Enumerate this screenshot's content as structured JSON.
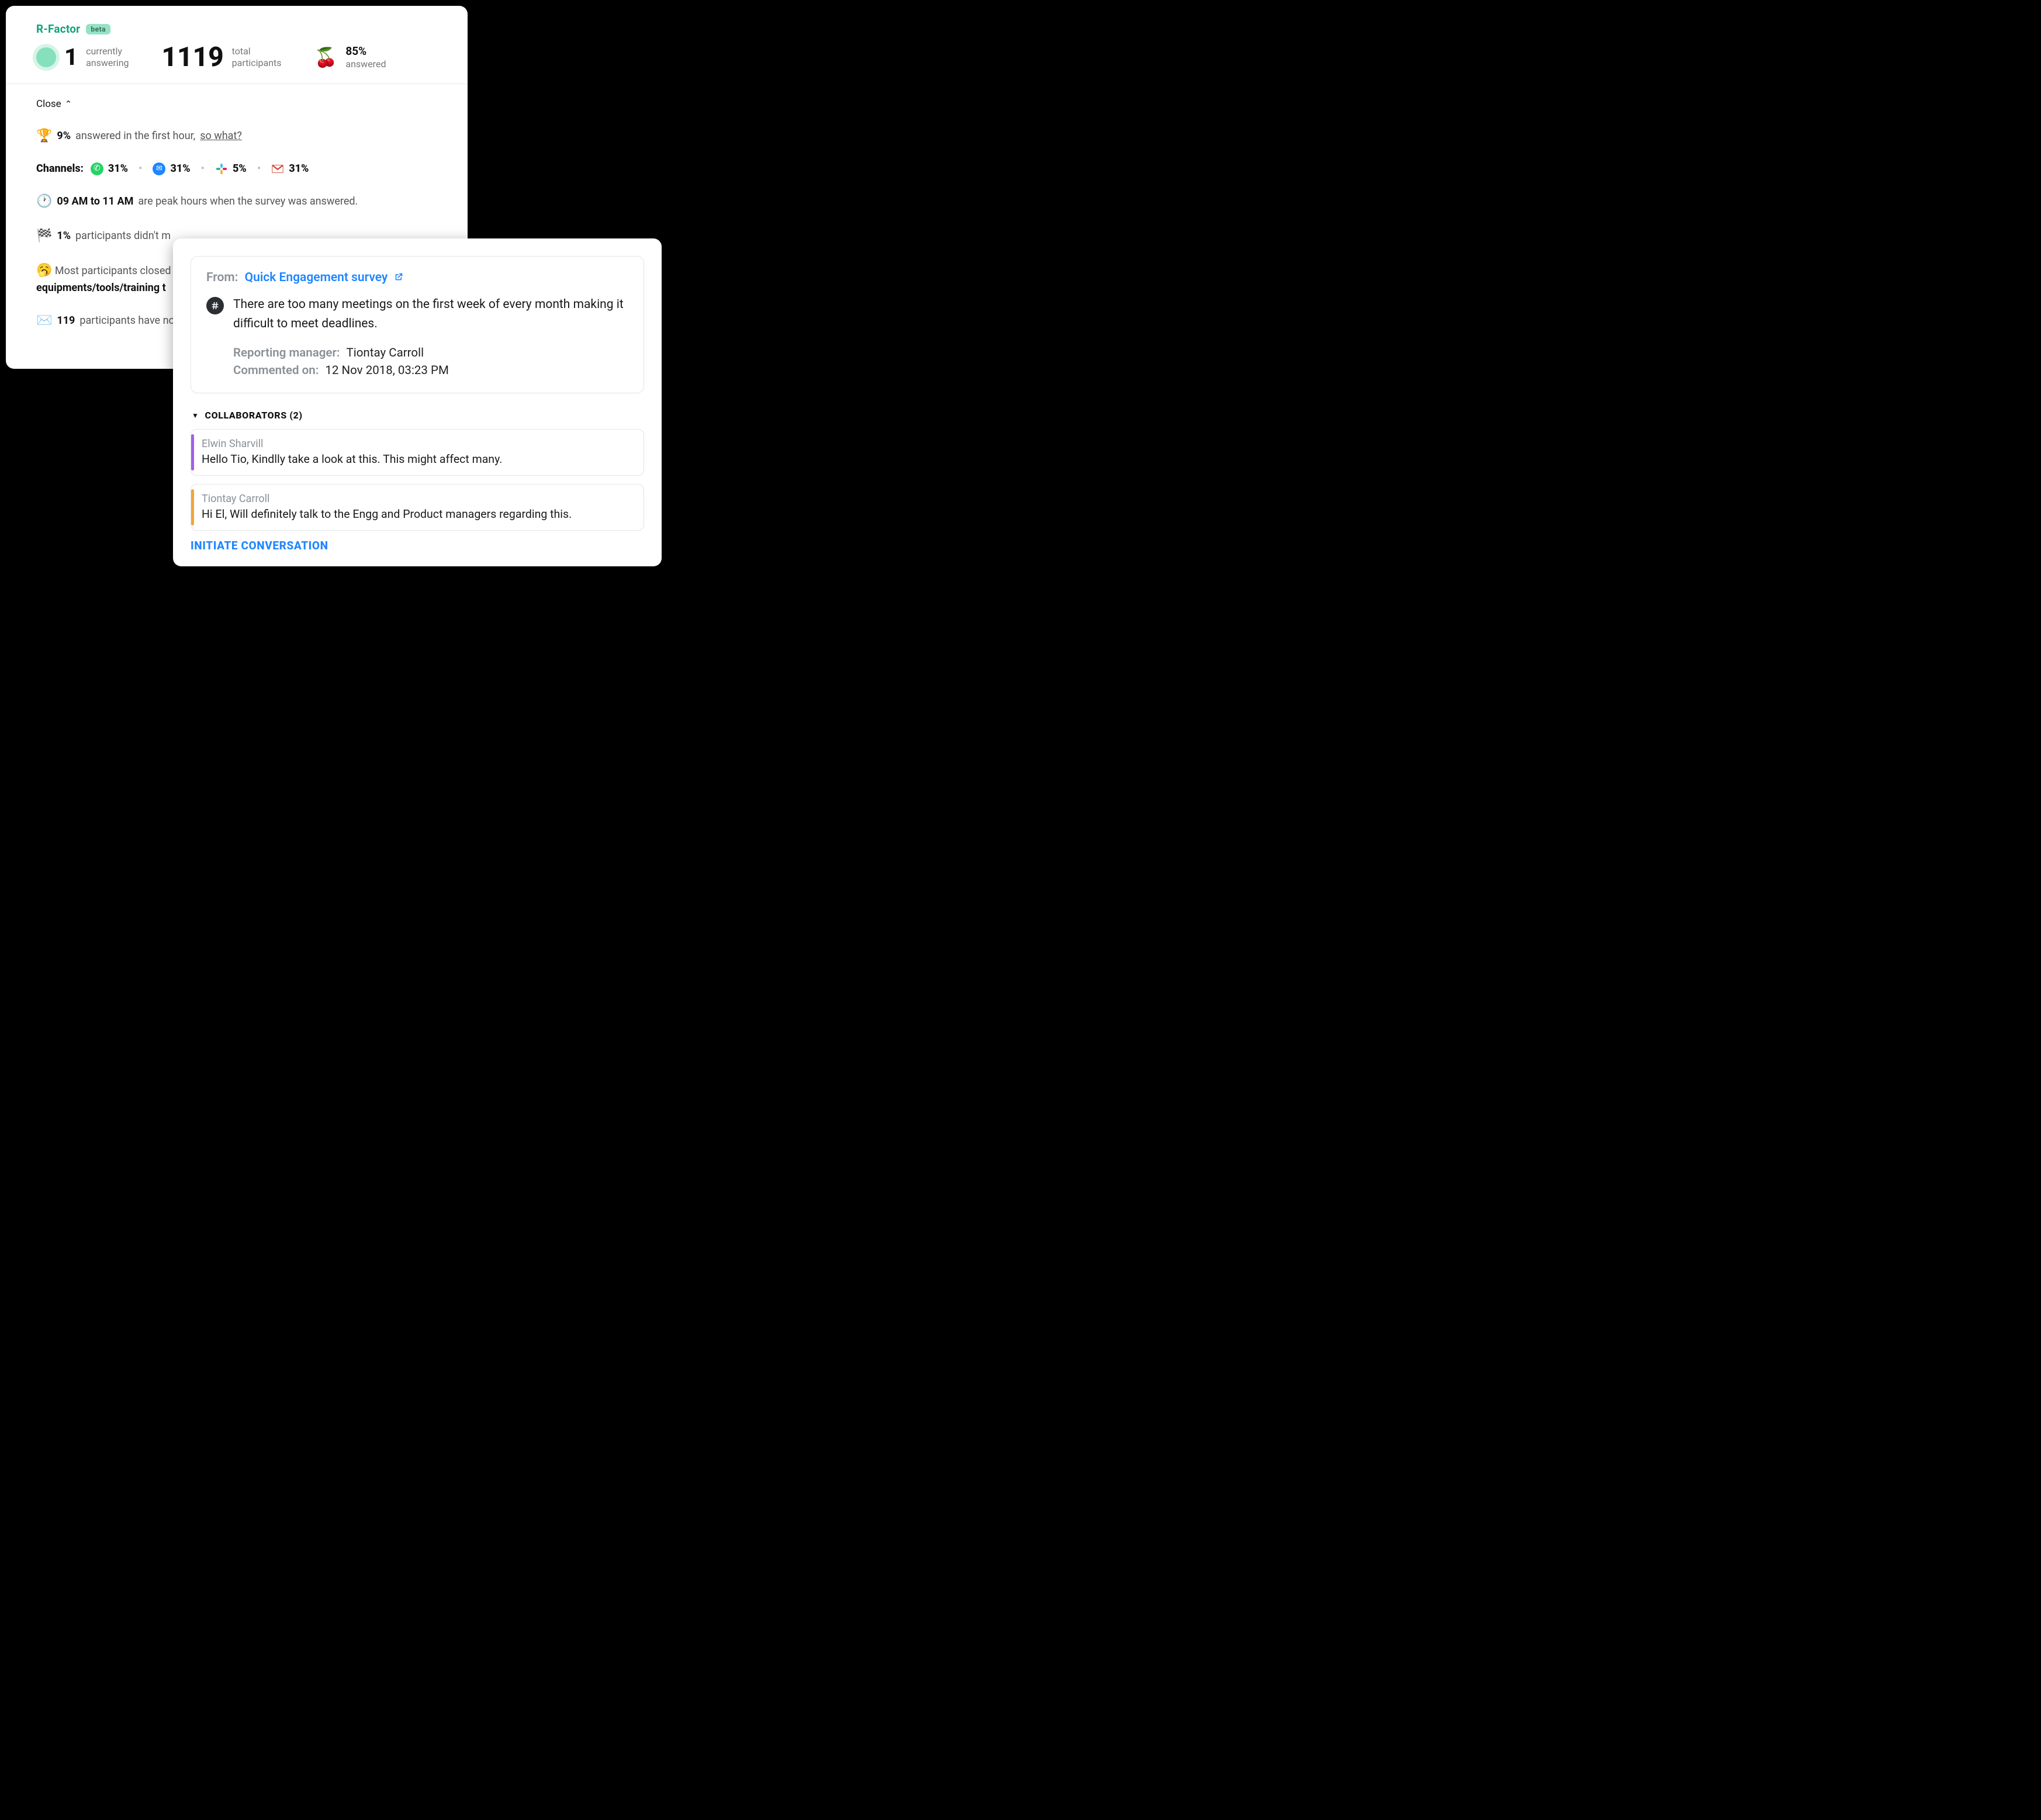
{
  "cardA": {
    "title": "R-Factor",
    "badge": "beta",
    "stats": {
      "live": {
        "count": "1",
        "l1": "currently",
        "l2": "answering"
      },
      "total": {
        "count": "1119",
        "l1": "total",
        "l2": "participants"
      },
      "answered": {
        "pct": "85%",
        "label": "answered",
        "emoji": "🍒"
      }
    },
    "close": "Close",
    "insights": {
      "trophy": {
        "emoji": "🏆",
        "pct": "9%",
        "text": "answered in the first hour,",
        "link": "so what?"
      },
      "channels": {
        "lead": "Channels:",
        "items": [
          {
            "name": "whatsapp",
            "pct": "31%"
          },
          {
            "name": "messenger",
            "pct": "31%"
          },
          {
            "name": "slack",
            "pct": "5%"
          },
          {
            "name": "gmail",
            "pct": "31%"
          }
        ]
      },
      "clock": {
        "emoji": "🕐",
        "bold": "09 AM to 11 AM",
        "rest": "are peak hours when the survey was answered."
      },
      "flag": {
        "emoji": "🏁",
        "pct": "1%",
        "rest": "participants didn't m"
      },
      "yawn": {
        "emoji": "🥱",
        "line1": "Most participants closed",
        "bold2": "equipments/tools/training t"
      },
      "mail": {
        "emoji": "✉️",
        "bold": "119",
        "rest": "participants have no"
      }
    }
  },
  "cardB": {
    "from": {
      "label": "From:",
      "link": "Quick Engagement survey"
    },
    "comment": "There are too many meetings on the first week of every month making it difficult to meet deadlines.",
    "meta": {
      "manager": {
        "label": "Reporting manager:",
        "value": "Tiontay Carroll"
      },
      "date": {
        "label": "Commented on:",
        "value": "12 Nov 2018, 03:23 PM"
      }
    },
    "collab": {
      "header": "COLLABORATORS (2)",
      "notes": [
        {
          "name": "Elwin Sharvill",
          "body": "Hello Tio, Kindlly take a look at this. This might affect many.",
          "accent": "purple"
        },
        {
          "name": "Tiontay Carroll",
          "body": "Hi El, Will definitely talk to the Engg and Product managers regarding this.",
          "accent": "orange"
        }
      ]
    },
    "cta": "INITIATE CONVERSATION"
  }
}
